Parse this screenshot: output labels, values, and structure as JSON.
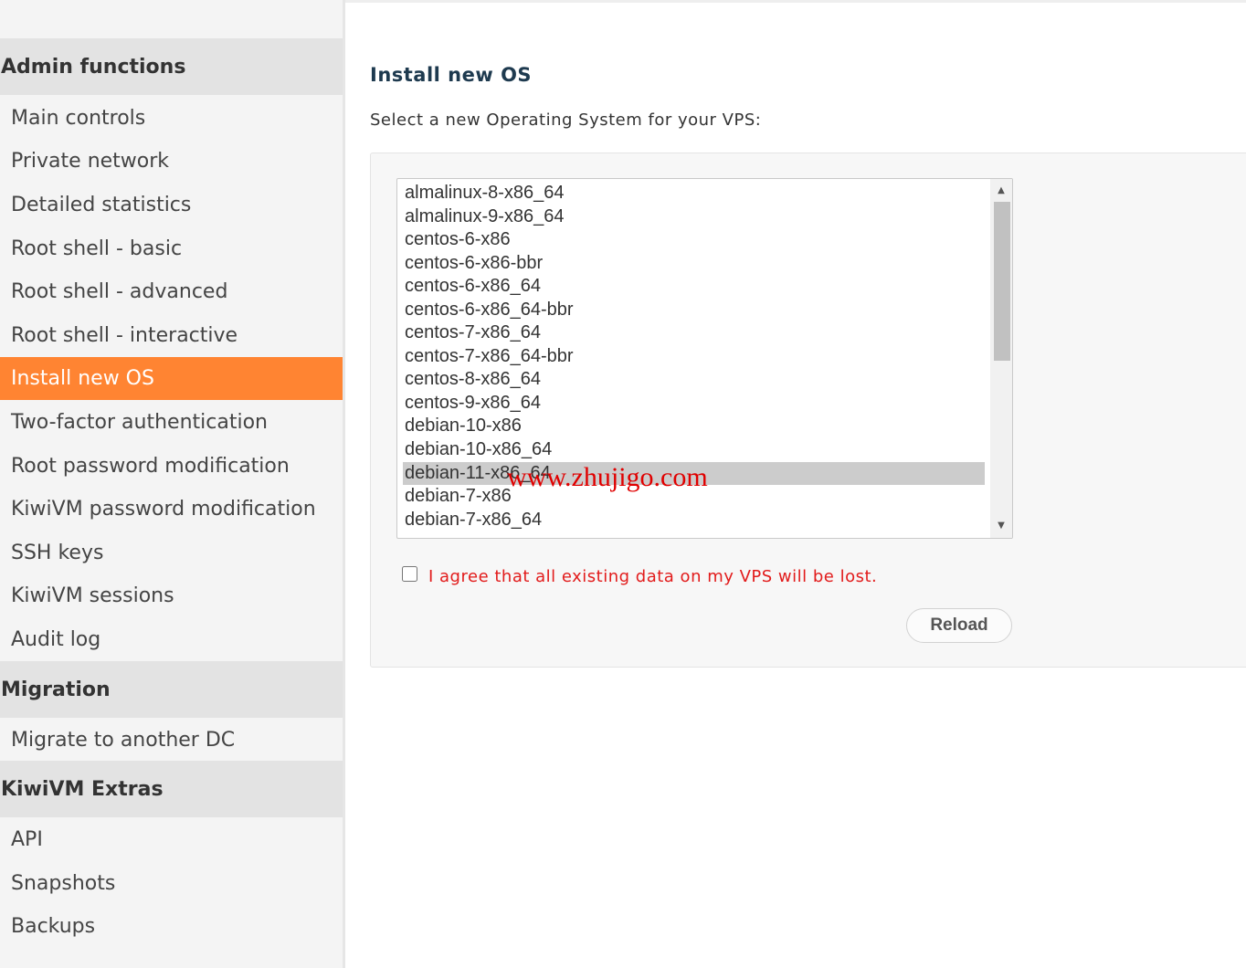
{
  "sidebar": {
    "sections": [
      {
        "title": "Admin functions",
        "items": [
          "Main controls",
          "Private network",
          "Detailed statistics",
          "Root shell - basic",
          "Root shell - advanced",
          "Root shell - interactive",
          "Install new OS",
          "Two-factor authentication",
          "Root password modification",
          "KiwiVM password modification",
          "SSH keys",
          "KiwiVM sessions",
          "Audit log"
        ]
      },
      {
        "title": "Migration",
        "items": [
          "Migrate to another DC"
        ]
      },
      {
        "title": "KiwiVM Extras",
        "items": [
          "API",
          "Snapshots",
          "Backups"
        ]
      }
    ],
    "active_item": "Install new OS"
  },
  "main": {
    "title": "Install new OS",
    "subtitle": "Select a new Operating System for your VPS:",
    "os_list": {
      "options": [
        "almalinux-8-x86_64",
        "almalinux-9-x86_64",
        "centos-6-x86",
        "centos-6-x86-bbr",
        "centos-6-x86_64",
        "centos-6-x86_64-bbr",
        "centos-7-x86_64",
        "centos-7-x86_64-bbr",
        "centos-8-x86_64",
        "centos-9-x86_64",
        "debian-10-x86",
        "debian-10-x86_64",
        "debian-11-x86_64",
        "debian-7-x86",
        "debian-7-x86_64"
      ],
      "selected": "debian-11-x86_64"
    },
    "agree_label": "I agree that all existing data on my VPS will be lost.",
    "agree_checked": false,
    "reload_label": "Reload"
  },
  "watermark": "www.zhujigo.com",
  "colors": {
    "active_bg": "#ff8432",
    "warning_text": "#e21b1b",
    "title_text": "#1e3a4f"
  }
}
